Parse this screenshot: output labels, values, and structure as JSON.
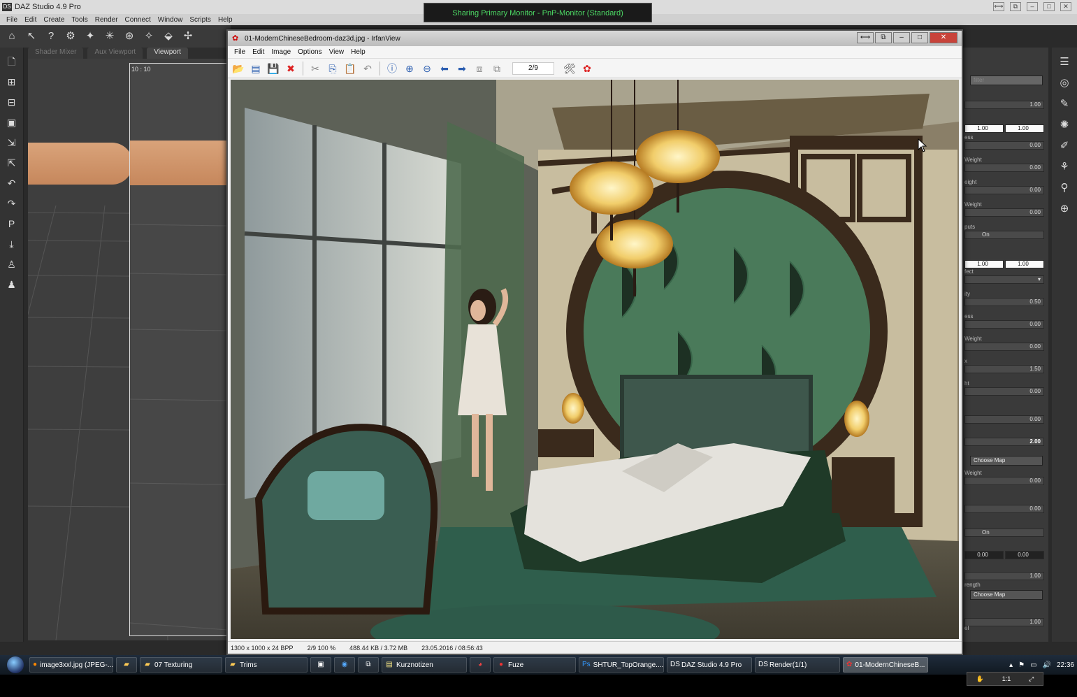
{
  "daz": {
    "title": "DAZ Studio 4.9 Pro",
    "logo": "DS",
    "menu": [
      "File",
      "Edit",
      "Create",
      "Tools",
      "Render",
      "Connect",
      "Window",
      "Scripts",
      "Help"
    ],
    "tabs": [
      "Shader Mixer",
      "Aux Viewport",
      "Viewport"
    ],
    "viewport_ratio": "10 : 10"
  },
  "remote_banner": "Sharing Primary Monitor - PnP-Monitor (Standard)",
  "irfan": {
    "title": "01-ModernChineseBedroom-daz3d.jpg - IrfanView",
    "menu": [
      "File",
      "Edit",
      "Image",
      "Options",
      "View",
      "Help"
    ],
    "page_indicator": "2/9",
    "status": {
      "dimensions": "1300 x 1000 x 24 BPP",
      "position_zoom": "2/9  100 %",
      "size": "488.44 KB / 3.72 MB",
      "date": "23.05.2016 / 08:56:43"
    }
  },
  "right_panel": {
    "values": {
      "v1": "1.00",
      "v2a": "1.00",
      "v2b": "1.00",
      "v3": "0.00",
      "v4": "0.00",
      "v5": "0.00",
      "v6": "0.00",
      "on1": "On",
      "v7a": "1.00",
      "v7b": "1.00",
      "v8": "0.50",
      "v9": "0.00",
      "v10": "0.00",
      "v11": "1.50",
      "v12": "0.00",
      "v13": "0.00",
      "v14": "2.00",
      "v15": "0.00",
      "v16": "0.00",
      "on2": "On",
      "v17a": "0.00",
      "v17b": "0.00",
      "v18": "1.00",
      "v19": "1.00"
    },
    "labels": {
      "l1": "ess",
      "l2": "Weight",
      "l3": "eight",
      "l4": "Weight",
      "l5": "puts",
      "l6": "fect",
      "l7": "ity",
      "l8": "ess",
      "l9": "Weight",
      "l10": "x",
      "l11": "ht",
      "l12": "Weight",
      "l13": "rength",
      "l14": "el"
    },
    "choose_map": "Choose Map"
  },
  "taskbar": {
    "items": [
      {
        "label": "image3xxl.jpg (JPEG-...",
        "icon": "firefox-icon"
      },
      {
        "label": "",
        "icon": "folder-icon"
      },
      {
        "label": "07 Texturing",
        "icon": "folder-icon"
      },
      {
        "label": "Trims",
        "icon": "folder-icon"
      },
      {
        "label": "",
        "icon": "app-icon"
      },
      {
        "label": "",
        "icon": "ie-icon"
      },
      {
        "label": "",
        "icon": "remote-icon"
      },
      {
        "label": "Kurznotizen",
        "icon": "notes-icon"
      },
      {
        "label": "",
        "icon": "chrome-icon"
      },
      {
        "label": "Fuze",
        "icon": "fuze-icon"
      },
      {
        "label": "SHTUR_TopOrange....",
        "icon": "photoshop-icon"
      },
      {
        "label": "DAZ Studio 4.9 Pro",
        "icon": "daz-icon"
      },
      {
        "label": "Render(1/1)",
        "icon": "daz-icon"
      },
      {
        "label": "01-ModernChineseB...",
        "icon": "irfan-icon"
      }
    ],
    "clock": "22:36"
  },
  "mini_ctrl": {
    "zoom": "1:1"
  },
  "colors": {
    "banner_text": "#4cd964",
    "daz_bg": "#3a3a3a",
    "skin": "#d9a37a"
  }
}
